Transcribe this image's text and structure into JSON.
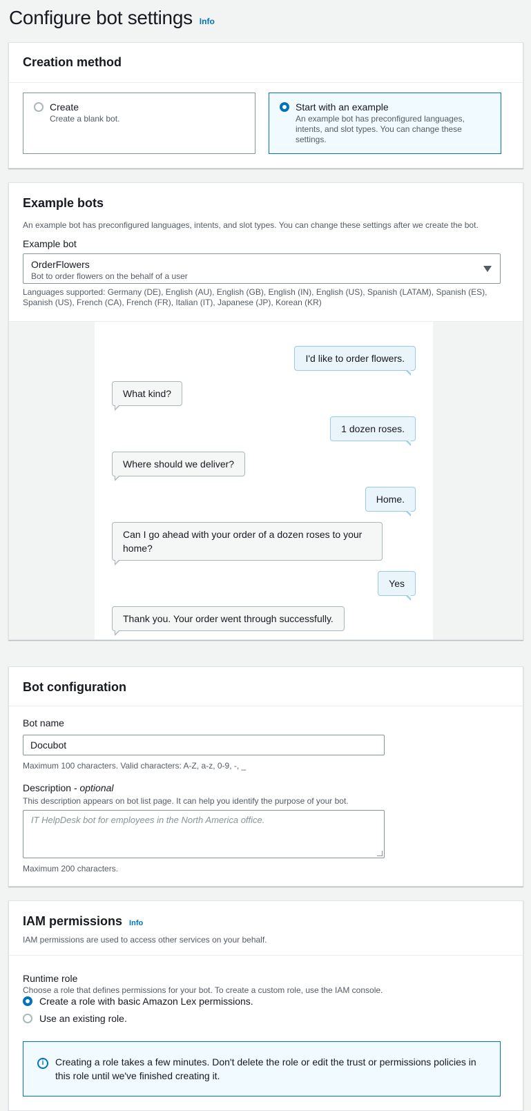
{
  "page": {
    "title": "Configure bot settings",
    "info": "Info"
  },
  "creation": {
    "title": "Creation method",
    "options": [
      {
        "label": "Create",
        "desc": "Create a blank bot.",
        "selected": false
      },
      {
        "label": "Start with an example",
        "desc": "An example bot has preconfigured languages, intents, and slot types. You can change these settings.",
        "selected": true
      }
    ]
  },
  "examples": {
    "title": "Example bots",
    "desc": "An example bot has preconfigured languages, intents, and slot types. You can change these settings after we create the bot.",
    "field_label": "Example bot",
    "selected_name": "OrderFlowers",
    "selected_desc": "Bot to order flowers on the behalf of a user",
    "languages": "Languages supported: Germany (DE), English (AU), English (GB), English (IN), English (US), Spanish (LATAM), Spanish (ES), Spanish (US), French (CA), French (FR), Italian (IT), Japanese (JP), Korean (KR)",
    "conversation": [
      {
        "from": "user",
        "text": "I'd like to order flowers."
      },
      {
        "from": "bot",
        "text": "What kind?"
      },
      {
        "from": "user",
        "text": "1 dozen roses."
      },
      {
        "from": "bot",
        "text": "Where should we deliver?"
      },
      {
        "from": "user",
        "text": "Home."
      },
      {
        "from": "bot",
        "text": "Can I go ahead with your order of a dozen roses to your home?"
      },
      {
        "from": "user",
        "text": "Yes"
      },
      {
        "from": "bot",
        "text": "Thank you. Your order went through successfully."
      }
    ]
  },
  "config": {
    "title": "Bot configuration",
    "name_label": "Bot name",
    "name_value": "Docubot",
    "name_hint": "Maximum 100 characters. Valid characters: A-Z, a-z, 0-9, -, _",
    "desc_label": "Description",
    "desc_optional": "- optional",
    "desc_help": "This description appears on bot list page. It can help you identify the purpose of your bot.",
    "desc_placeholder": "IT HelpDesk bot for employees in the North America office.",
    "desc_hint": "Maximum 200 characters."
  },
  "iam": {
    "title": "IAM permissions",
    "info": "Info",
    "desc": "IAM permissions are used to access other services on your behalf.",
    "role_label": "Runtime role",
    "role_desc": "Choose a role that defines permissions for your bot. To create a custom role, use the IAM console.",
    "options": [
      {
        "label": "Create a role with basic Amazon Lex permissions.",
        "selected": true
      },
      {
        "label": "Use an existing role.",
        "selected": false
      }
    ],
    "alert": "Creating a role takes a few minutes. Don't delete the role or edit the trust or permissions policies in this role until we've finished creating it."
  },
  "colors": {
    "accent": "#0073bb",
    "user_bubble": "#eaf5fb",
    "bot_bubble": "#f5f7f7"
  }
}
